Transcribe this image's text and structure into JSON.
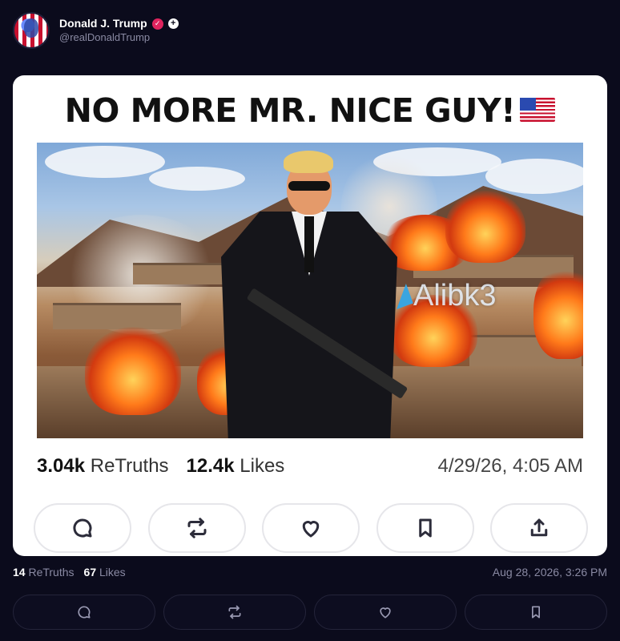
{
  "post": {
    "author_name": "Donald J. Trump",
    "handle": "@realDonaldTrump",
    "verified_icon": "verified-badge-icon",
    "follow_icon": "plus-icon"
  },
  "card": {
    "headline": "NO MORE MR. NICE GUY!",
    "flag_icon": "us-flag-icon",
    "watermark": "Alibk3",
    "retruths_count": "3.04k",
    "retruths_label": "ReTruths",
    "likes_count": "12.4k",
    "likes_label": "Likes",
    "timestamp": "4/29/26, 4:05 AM",
    "actions": [
      "comment-icon",
      "retruth-icon",
      "like-icon",
      "bookmark-icon",
      "share-icon"
    ]
  },
  "outer": {
    "retruths_count": "14",
    "retruths_label": "ReTruths",
    "likes_count": "67",
    "likes_label": "Likes",
    "timestamp": "Aug 28, 2026, 3:26 PM",
    "actions": [
      "comment-icon",
      "retruth-icon",
      "like-icon",
      "bookmark-icon"
    ]
  },
  "colors": {
    "background": "#0b0b1c",
    "card": "#ffffff",
    "verified": "#e0245e"
  }
}
